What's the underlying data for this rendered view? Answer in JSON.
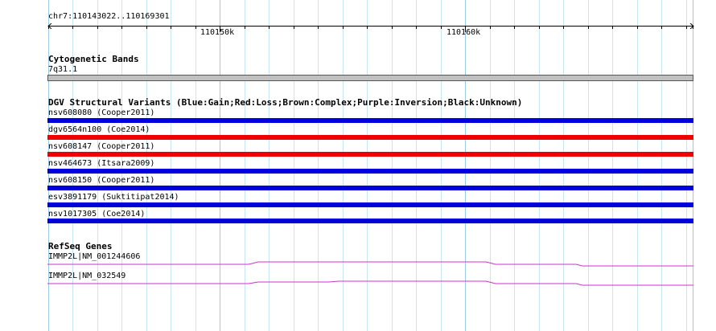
{
  "location": "chr7:110143022..110169301",
  "ruler": {
    "labels": [
      "110150k",
      "110160k"
    ]
  },
  "tracks": {
    "cytogenetic": {
      "title": "Cytogenetic Bands",
      "band_label": "7q31.1"
    },
    "dgv": {
      "title": "DGV Structural Variants (Blue:Gain;Red:Loss;Brown:Complex;Purple:Inversion;Black:Unknown)",
      "variants": [
        {
          "label": "nsv608080 (Cooper2011)",
          "color": "#0000dd"
        },
        {
          "label": "dgv6564n100 (Coe2014)",
          "color": "#ee0000"
        },
        {
          "label": "nsv608147 (Cooper2011)",
          "color": "#ee0000"
        },
        {
          "label": "nsv464673 (Itsara2009)",
          "color": "#0000dd"
        },
        {
          "label": "nsv608150 (Cooper2011)",
          "color": "#0000dd"
        },
        {
          "label": "esv3891179 (Suktitipat2014)",
          "color": "#0000dd"
        },
        {
          "label": "nsv1017305 (Coe2014)",
          "color": "#0000dd"
        }
      ]
    },
    "refseq": {
      "title": "RefSeq Genes",
      "genes": [
        {
          "label": "IMMP2L|NM_001244606",
          "color": "#cc33cc"
        },
        {
          "label": "IMMP2L|NM_032549",
          "color": "#cc33cc"
        }
      ]
    }
  }
}
